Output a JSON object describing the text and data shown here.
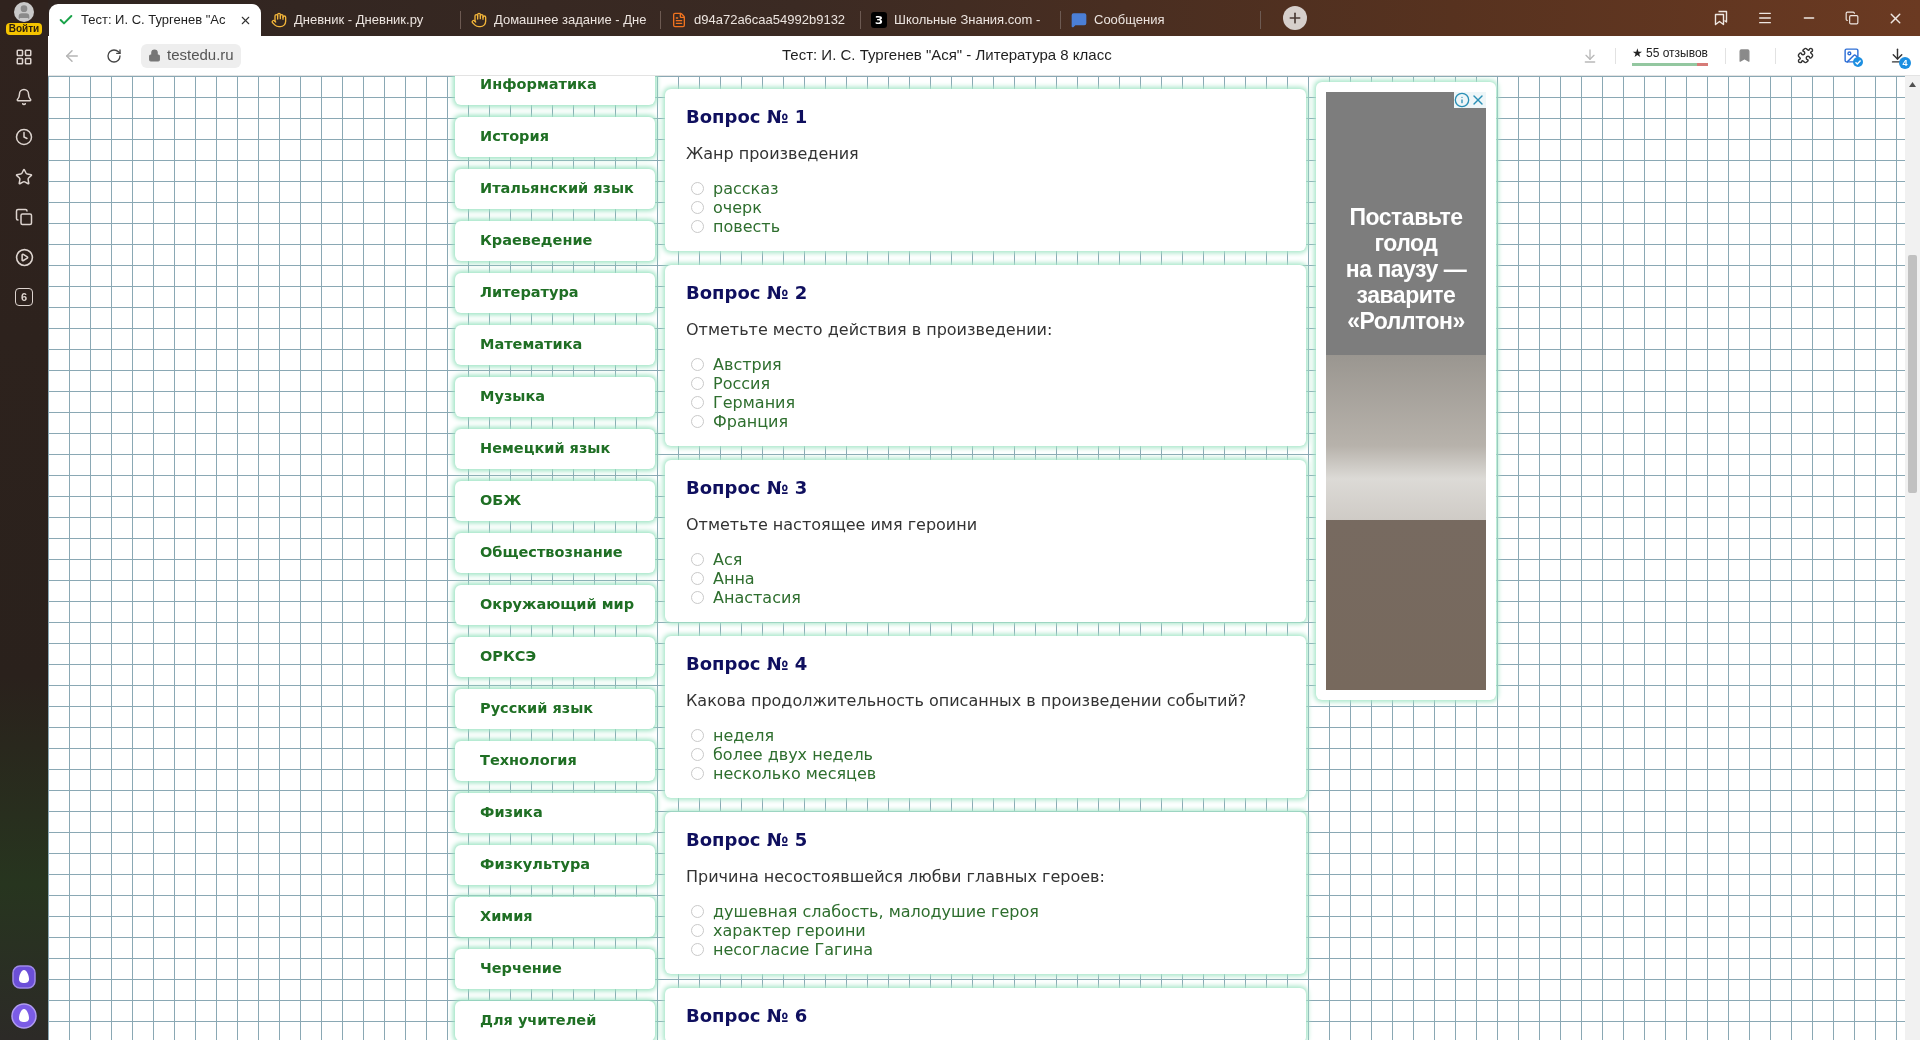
{
  "browser": {
    "sidebar": {
      "login_label": "Войти",
      "badge": "6"
    },
    "tabs": [
      {
        "title": "Тест: И. С. Тургенев \"Ас",
        "selected": true
      },
      {
        "title": "Дневник - Дневник.ру",
        "selected": false
      },
      {
        "title": "Домашнее задание - Дне",
        "selected": false
      },
      {
        "title": "d94a72a6caa54992b9132",
        "selected": false
      },
      {
        "title": "Школьные Знания.com -",
        "selected": false,
        "favicon_text": "З"
      },
      {
        "title": "Сообщения",
        "selected": false
      }
    ],
    "address_bar": {
      "domain": "testedu.ru",
      "page_title": "Тест: И. С. Тургенев \"Ася\" - Литература 8 класс",
      "reviews": {
        "label": "★ 55 отзывов",
        "level": 0.85
      },
      "downloads_badge": "4"
    }
  },
  "nav": {
    "items": [
      "Информатика",
      "История",
      "Итальянский язык",
      "Краеведение",
      "Литература",
      "Математика",
      "Музыка",
      "Немецкий язык",
      "ОБЖ",
      "Обществознание",
      "Окружающий мир",
      "ОРКСЭ",
      "Русский язык",
      "Технология",
      "Физика",
      "Физкультура",
      "Химия",
      "Черчение",
      "Для учителей"
    ]
  },
  "questions": [
    {
      "title": "Вопрос № 1",
      "text": "Жанр произведения",
      "options": [
        {
          "label": "рассказ",
          "selected": false
        },
        {
          "label": "очерк",
          "selected": false
        },
        {
          "label": "повесть",
          "selected": false
        }
      ]
    },
    {
      "title": "Вопрос № 2",
      "text": "Отметьте место действия в произведении:",
      "options": [
        {
          "label": "Австрия",
          "selected": false
        },
        {
          "label": "Россия",
          "selected": false
        },
        {
          "label": "Германия",
          "selected": false
        },
        {
          "label": "Франция",
          "selected": false
        }
      ]
    },
    {
      "title": "Вопрос № 3",
      "text": "Отметьте настоящее имя героини",
      "options": [
        {
          "label": "Ася",
          "selected": false
        },
        {
          "label": "Анна",
          "selected": false
        },
        {
          "label": "Анастасия",
          "selected": false
        }
      ]
    },
    {
      "title": "Вопрос № 4",
      "text": "Какова продолжительность описанных в произведении событий?",
      "options": [
        {
          "label": "неделя",
          "selected": false
        },
        {
          "label": "более двух недель",
          "selected": false
        },
        {
          "label": "несколько месяцев",
          "selected": false
        }
      ]
    },
    {
      "title": "Вопрос № 5",
      "text": "Причина несостоявшейся любви главных героев:",
      "options": [
        {
          "label": "душевная слабость, малодушие героя",
          "selected": false
        },
        {
          "label": "характер героини",
          "selected": false
        },
        {
          "label": "несогласие Гагина",
          "selected": false
        }
      ]
    },
    {
      "title": "Вопрос № 6"
    }
  ],
  "ad": {
    "headline_lines": [
      "Поставьте",
      "голод",
      "на паузу —",
      "заварите",
      "«Роллтон»"
    ]
  }
}
